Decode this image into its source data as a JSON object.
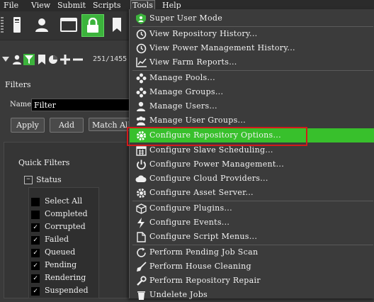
{
  "menubar": {
    "items": [
      {
        "label": "File"
      },
      {
        "label": "View"
      },
      {
        "label": "Submit"
      },
      {
        "label": "Scripts"
      },
      {
        "label": "Tools"
      },
      {
        "label": "Help"
      }
    ]
  },
  "toolbar": {
    "icons": [
      "monitor-icon",
      "user-icon",
      "window-icon",
      "lock-icon",
      "bookmark-icon"
    ]
  },
  "subtoolbar": {
    "counter": "251/1455"
  },
  "filters": {
    "title": "Filters",
    "name_label": "Name",
    "name_value": "Filter",
    "apply_label": "Apply",
    "add_label": "Add",
    "match_label": "Match All"
  },
  "quick_filters": {
    "title": "Quick Filters",
    "status_label": "Status",
    "expand_glyph": "−",
    "items": [
      {
        "label": "Select All",
        "checked": false
      },
      {
        "label": "Completed",
        "checked": false
      },
      {
        "label": "Corrupted",
        "checked": true
      },
      {
        "label": "Failed",
        "checked": true
      },
      {
        "label": "Queued",
        "checked": true
      },
      {
        "label": "Pending",
        "checked": true
      },
      {
        "label": "Rendering",
        "checked": true
      },
      {
        "label": "Suspended",
        "checked": true
      }
    ]
  },
  "tools_menu": {
    "items": [
      {
        "label": "Super User Mode",
        "icon": "shield-icon"
      },
      {
        "label": "View Repository History...",
        "icon": "history-icon"
      },
      {
        "label": "View Power Management History...",
        "icon": "history-icon"
      },
      {
        "label": "View Farm Reports...",
        "icon": "chart-icon"
      },
      {
        "label": "Manage Pools...",
        "icon": "pools-icon"
      },
      {
        "label": "Manage Groups...",
        "icon": "groups-icon"
      },
      {
        "label": "Manage Users...",
        "icon": "user-icon"
      },
      {
        "label": "Manage User Groups...",
        "icon": "user-groups-icon"
      },
      {
        "label": "Configure Repository Options...",
        "icon": "gear-icon"
      },
      {
        "label": "Configure Slave Scheduling...",
        "icon": "calendar-icon"
      },
      {
        "label": "Configure Power Management...",
        "icon": "power-icon"
      },
      {
        "label": "Configure Cloud Providers...",
        "icon": "cloud-icon"
      },
      {
        "label": "Configure Asset Server...",
        "icon": "gear-icon"
      },
      {
        "label": "Configure Plugins...",
        "icon": "cube-icon"
      },
      {
        "label": "Configure Events...",
        "icon": "lightning-icon"
      },
      {
        "label": "Configure Script Menus...",
        "icon": "document-icon"
      },
      {
        "label": "Perform Pending Job Scan",
        "icon": "refresh-icon"
      },
      {
        "label": "Perform House Cleaning",
        "icon": "broom-icon"
      },
      {
        "label": "Perform Repository Repair",
        "icon": "wrench-icon"
      },
      {
        "label": "Undelete Jobs",
        "icon": "undelete-icon"
      }
    ]
  },
  "colors": {
    "highlight": "#38c02c",
    "annotation_box": "#d21a1a",
    "toolbar_green": "#3cb33c"
  }
}
